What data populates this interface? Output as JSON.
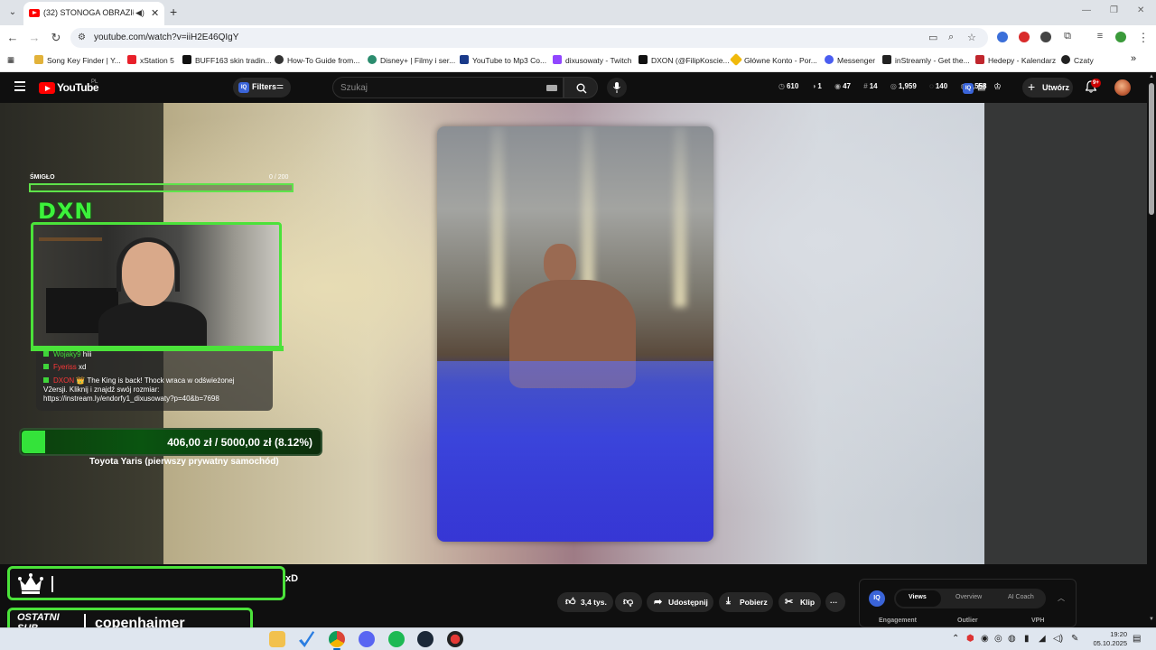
{
  "browser": {
    "tab": {
      "title": "(32) STONOGA OBRAZIŁ SI"
    },
    "url": "youtube.com/watch?v=iiH2E46QIgY",
    "bookmarks": [
      {
        "label": "Song Key Finder | Y...",
        "color": "#e2b23a"
      },
      {
        "label": "xStation 5",
        "color": "#e8202a"
      },
      {
        "label": "BUFF163 skin tradin...",
        "color": "#111111"
      },
      {
        "label": "How-To Guide from...",
        "color": "#333333"
      },
      {
        "label": "Disney+ | Filmy i ser...",
        "color": "#2b8c6e"
      },
      {
        "label": "YouTube to Mp3 Co...",
        "color": "#1a3a8a"
      },
      {
        "label": "dixusowaty - Twitch",
        "color": "#9146ff"
      },
      {
        "label": "DXON (@FilipKoscie...",
        "color": "#111111"
      },
      {
        "label": "Główne Konto - Por...",
        "color": "#f0b90b"
      },
      {
        "label": "Messenger",
        "color": "#4a5df0"
      },
      {
        "label": "inStreamly - Get the...",
        "color": "#222222"
      },
      {
        "label": "Hedepy - Kalendarz",
        "color": "#c0262d"
      },
      {
        "label": "Czaty",
        "color": "#222222"
      }
    ]
  },
  "youtube": {
    "logo_text": "YouTube",
    "region": "PL",
    "filters_label": "Filters",
    "iq_label": "IQ",
    "search_placeholder": "Szukaj",
    "stats": [
      "610",
      "1",
      "47",
      "14",
      "1,959",
      "140",
      "1,558"
    ],
    "create_label": "Utwórz",
    "notifications": "9+"
  },
  "overlay": {
    "goal_label": "ŚMIGŁO",
    "goal_count": "0 / 200",
    "channel_logo": "DXN",
    "chat": [
      {
        "user": "Wojaky9",
        "message": "hiii"
      },
      {
        "user": "Fyeriss",
        "message": "xd"
      },
      {
        "user": "DXON",
        "message": "👑 The King is back! Thock wraca w odświeżonej"
      },
      {
        "user": "",
        "message": "V2ersji. Kliknij i znajdź swój rozmiar:"
      },
      {
        "user": "",
        "message": "https://instream.ly/endorfy1_dixusowaty?p=40&b=7698"
      }
    ],
    "donation": {
      "text": "406,00 zł  /  5000,00 zł (8.12%)",
      "progress": 0.0812,
      "description": "Toyota Yaris (pierwszy prywatny samochód)"
    },
    "sub_label_line1": "OSTATNI",
    "sub_label_line2": "SUB",
    "sub_name": "copenhaimer",
    "chat_fragment": "xD"
  },
  "actions": {
    "likes": "3,4 tys.",
    "share": "Udostępnij",
    "download": "Pobierz",
    "clip": "Klip",
    "more": "···"
  },
  "panel": {
    "iq": "IQ",
    "tabs": [
      "Views",
      "Overview",
      "AI Coach"
    ],
    "active_tab": "Views",
    "columns": [
      "Engagement",
      "Outlier",
      "VPH"
    ]
  },
  "taskbar": {
    "time": "19:20",
    "date": "05.10.2025"
  }
}
